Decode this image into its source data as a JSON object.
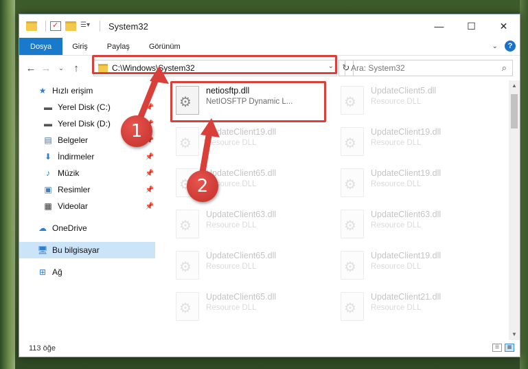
{
  "window": {
    "title": "System32",
    "controls": {
      "minimize": "—",
      "maximize": "☐",
      "close": "✕"
    }
  },
  "ribbon": {
    "tabs": [
      "Dosya",
      "Giriş",
      "Paylaş",
      "Görünüm"
    ],
    "help": "?"
  },
  "address": {
    "path": "C:\\Windows\\System32",
    "search_placeholder": "Ara: System32"
  },
  "sidebar": {
    "items": [
      {
        "label": "Hızlı erişim",
        "icon": "star-icon",
        "pinned": false
      },
      {
        "label": "Yerel Disk (C:)",
        "icon": "drive-icon",
        "pinned": true
      },
      {
        "label": "Yerel Disk (D:)",
        "icon": "drive-icon",
        "pinned": true
      },
      {
        "label": "Belgeler",
        "icon": "documents-icon",
        "pinned": true
      },
      {
        "label": "İndirmeler",
        "icon": "download-icon",
        "pinned": true
      },
      {
        "label": "Müzik",
        "icon": "music-icon",
        "pinned": true
      },
      {
        "label": "Resimler",
        "icon": "pictures-icon",
        "pinned": true
      },
      {
        "label": "Videolar",
        "icon": "video-icon",
        "pinned": true
      },
      {
        "label": "OneDrive",
        "icon": "cloud-icon",
        "pinned": false
      },
      {
        "label": "Bu bilgisayar",
        "icon": "computer-icon",
        "pinned": false
      },
      {
        "label": "Ağ",
        "icon": "network-icon",
        "pinned": false
      }
    ]
  },
  "files": [
    {
      "name": "netiosftp.dll",
      "type": "NetIOSFTP Dynamic L...",
      "highlighted": true
    },
    {
      "name": "UpdateClient5.dll",
      "type": "Resource DLL"
    },
    {
      "name": "UpdateClient19.dll",
      "type": "Resource DLL"
    },
    {
      "name": "UpdateClient19.dll",
      "type": "Resource DLL"
    },
    {
      "name": "UpdateClient65.dll",
      "type": "Resource DLL"
    },
    {
      "name": "UpdateClient19.dll",
      "type": "Resource DLL"
    },
    {
      "name": "UpdateClient63.dll",
      "type": "Resource DLL"
    },
    {
      "name": "UpdateClient63.dll",
      "type": "Resource DLL"
    },
    {
      "name": "UpdateClient65.dll",
      "type": "Resource DLL"
    },
    {
      "name": "UpdateClient19.dll",
      "type": "Resource DLL"
    },
    {
      "name": "UpdateClient65.dll",
      "type": "Resource DLL"
    },
    {
      "name": "UpdateClient21.dll",
      "type": "Resource DLL"
    }
  ],
  "status": {
    "count": "113 öğe"
  },
  "annotations": {
    "badge1": "1",
    "badge2": "2",
    "accent": "#d9403a"
  }
}
